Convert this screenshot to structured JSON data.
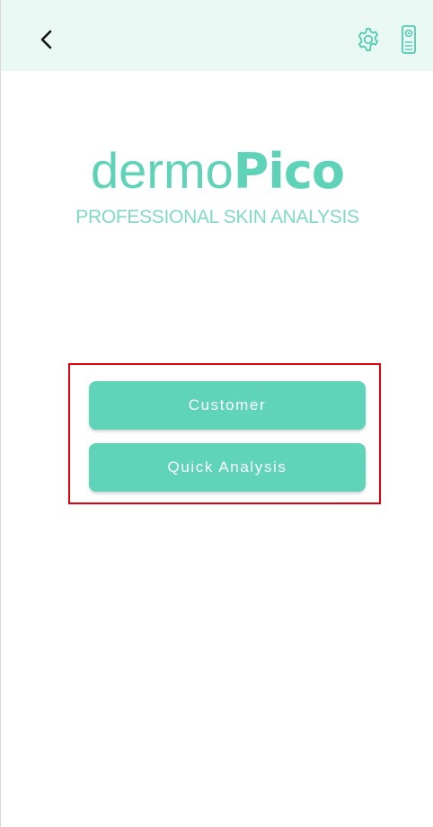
{
  "header": {
    "back_icon": "chevron-left-icon",
    "settings_icon": "gear-icon",
    "device_icon": "device-icon"
  },
  "logo": {
    "word_light": "dermo",
    "word_bold": "Pico",
    "tagline": "PROFESSIONAL SKIN ANALYSIS"
  },
  "actions": {
    "customer_label": "Customer",
    "quick_analysis_label": "Quick Analysis"
  },
  "colors": {
    "accent": "#5fd4b8",
    "header_bg": "#eaf8f4",
    "highlight": "#e0000b"
  }
}
